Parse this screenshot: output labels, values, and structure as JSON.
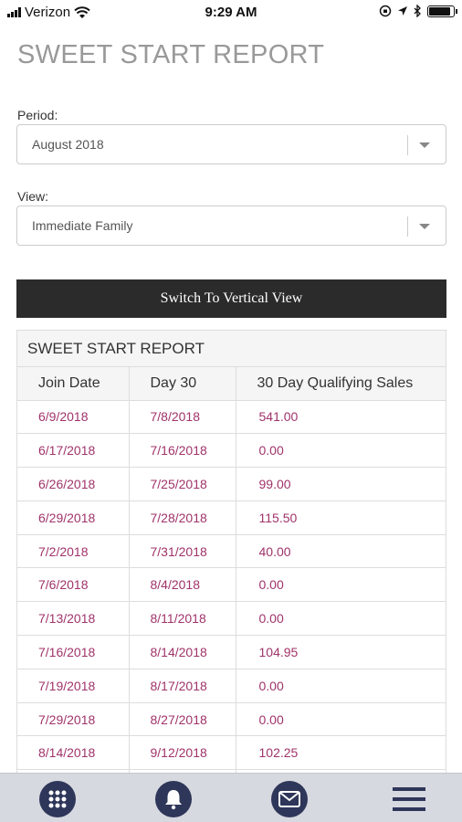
{
  "status_bar": {
    "carrier": "Verizon",
    "time": "9:29 AM",
    "battery_level": 0.9
  },
  "page": {
    "title": "SWEET START REPORT"
  },
  "period": {
    "label": "Period:",
    "value": "August 2018"
  },
  "view": {
    "label": "View:",
    "value": "Immediate Family"
  },
  "switch_button": {
    "label": "Switch To Vertical View"
  },
  "report": {
    "title": "SWEET START REPORT",
    "columns": [
      "Join Date",
      "Day 30",
      "30 Day Qualifying Sales"
    ],
    "rows": [
      [
        "6/9/2018",
        "7/8/2018",
        "541.00"
      ],
      [
        "6/17/2018",
        "7/16/2018",
        "0.00"
      ],
      [
        "6/26/2018",
        "7/25/2018",
        "99.00"
      ],
      [
        "6/29/2018",
        "7/28/2018",
        "115.50"
      ],
      [
        "7/2/2018",
        "7/31/2018",
        "40.00"
      ],
      [
        "7/6/2018",
        "8/4/2018",
        "0.00"
      ],
      [
        "7/13/2018",
        "8/11/2018",
        "0.00"
      ],
      [
        "7/16/2018",
        "8/14/2018",
        "104.95"
      ],
      [
        "7/19/2018",
        "8/17/2018",
        "0.00"
      ],
      [
        "7/29/2018",
        "8/27/2018",
        "0.00"
      ],
      [
        "8/14/2018",
        "9/12/2018",
        "102.25"
      ]
    ]
  },
  "tabbar": {
    "icons": [
      "grid-icon",
      "bell-icon",
      "mail-icon",
      "menu-icon"
    ]
  },
  "colors": {
    "accent_link": "#a0336a",
    "button_bg": "#2b2b2b",
    "tab_icon": "#2e3659",
    "tabbar_bg": "#d7d9e0"
  }
}
